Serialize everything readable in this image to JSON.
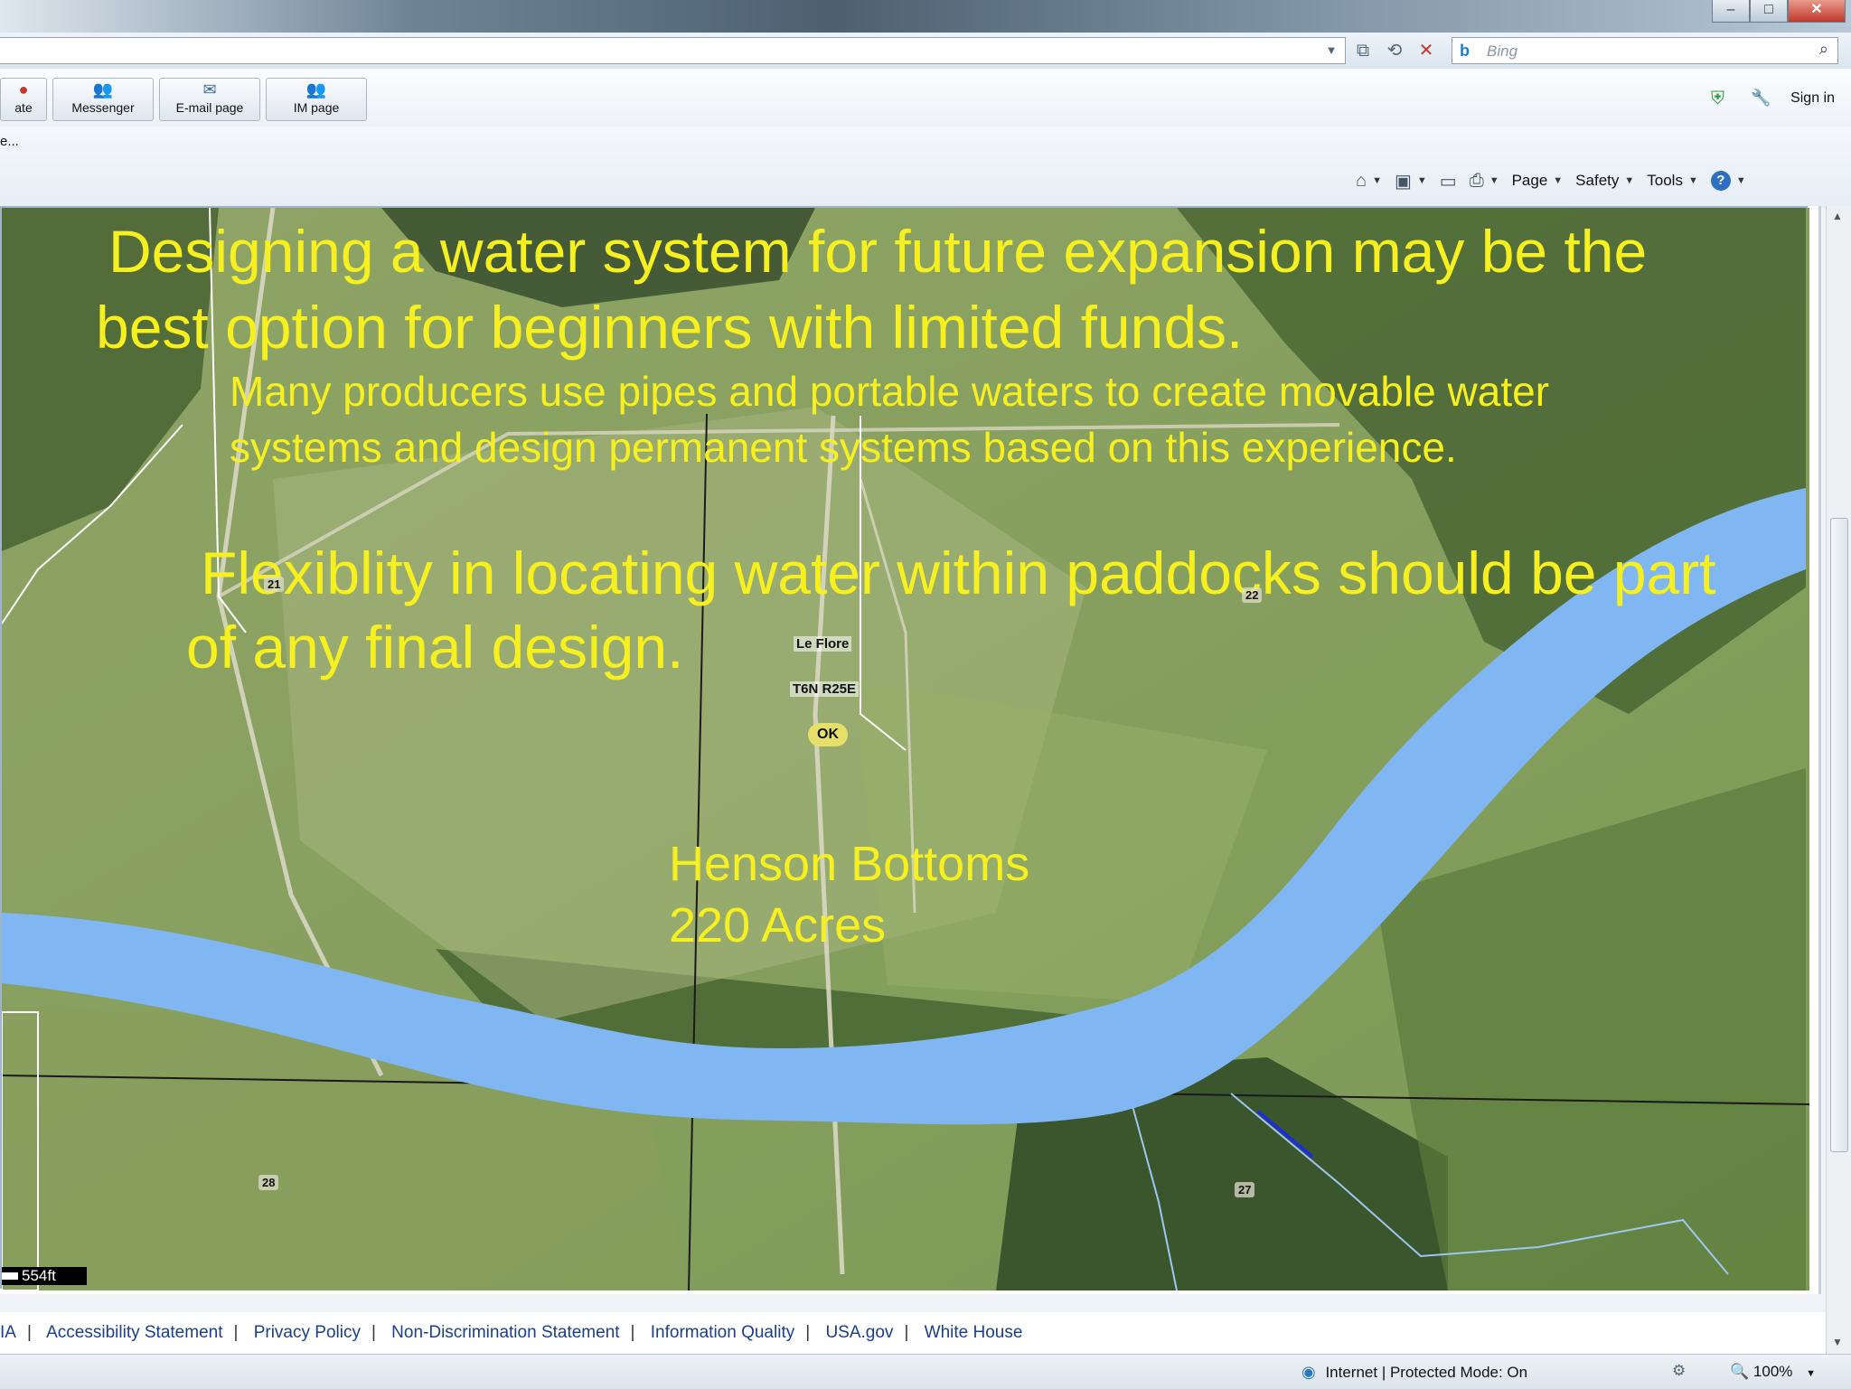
{
  "window": {
    "min": "–",
    "restore": "□",
    "close": "✕"
  },
  "search": {
    "placeholder": "Bing",
    "logo": "b"
  },
  "toolbar": {
    "partial_left": "ate",
    "buttons": [
      {
        "label": "Messenger",
        "icon": "messenger-icon"
      },
      {
        "label": "E-mail page",
        "icon": "email-icon"
      },
      {
        "label": "IM page",
        "icon": "im-icon"
      }
    ],
    "sign_in": "Sign in"
  },
  "favorites_partial": "e...",
  "command_bar": {
    "page": "Page",
    "safety": "Safety",
    "tools": "Tools",
    "help": "?"
  },
  "slide": {
    "headline": [
      "Designing a water system for future expansion may be  the",
      "best option for beginners with limited funds."
    ],
    "subtext": [
      "Many producers use pipes and portable waters to create movable water",
      "systems and design permanent systems based on this experience."
    ],
    "flex": [
      "Flexiblity in locating water within paddocks should be part",
      "of any final design."
    ],
    "farm": [
      "Henson Bottoms",
      "220 Acres"
    ]
  },
  "map": {
    "town": "Le Flore",
    "township": "T6N R25E",
    "state": "OK",
    "sections": [
      "21",
      "22",
      "28",
      "27"
    ],
    "scale": "554ft"
  },
  "footer": {
    "links": [
      "IA",
      "Accessibility Statement",
      "Privacy Policy",
      "Non-Discrimination Statement",
      "Information Quality",
      "USA.gov",
      "White House"
    ]
  },
  "status": {
    "zone": "Internet | Protected Mode: On",
    "zoom": "100%"
  },
  "colors": {
    "overlay_text": "#f6f020",
    "river": "#80b6f2",
    "link": "#1a3f8a"
  }
}
